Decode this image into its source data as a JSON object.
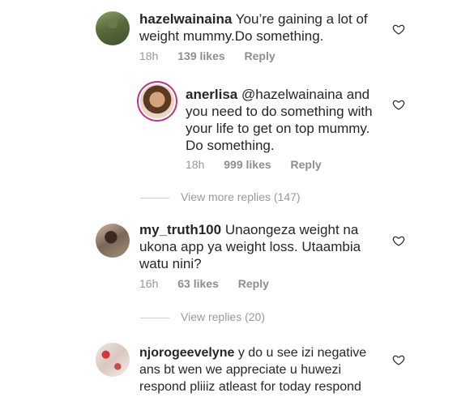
{
  "comments": [
    {
      "username": "hazelwainaina",
      "text": "You’re gaining a lot of weight mummy.Do something.",
      "time": "18h",
      "likes": "139 likes",
      "reply": "Reply"
    },
    {
      "username": "anerlisa",
      "mention": "@hazelwainaina",
      "text": " and you need to do something with your life to get on top mummy. Do something.",
      "time": "18h",
      "likes": "999 likes",
      "reply": "Reply"
    },
    {
      "username": "my_truth100",
      "text": "Unaongeza weight na ukona app ya weight loss. Utaambia watu nini?",
      "time": "16h",
      "likes": "63 likes",
      "reply": "Reply"
    },
    {
      "username": "njorogeevelyne",
      "text": "y do u see izi negative ans bt wen we appreciate u huwezi respond pliiiz atleast for today respond"
    }
  ],
  "view_more_replies": "View more replies (147)",
  "view_replies": "View replies (20)"
}
